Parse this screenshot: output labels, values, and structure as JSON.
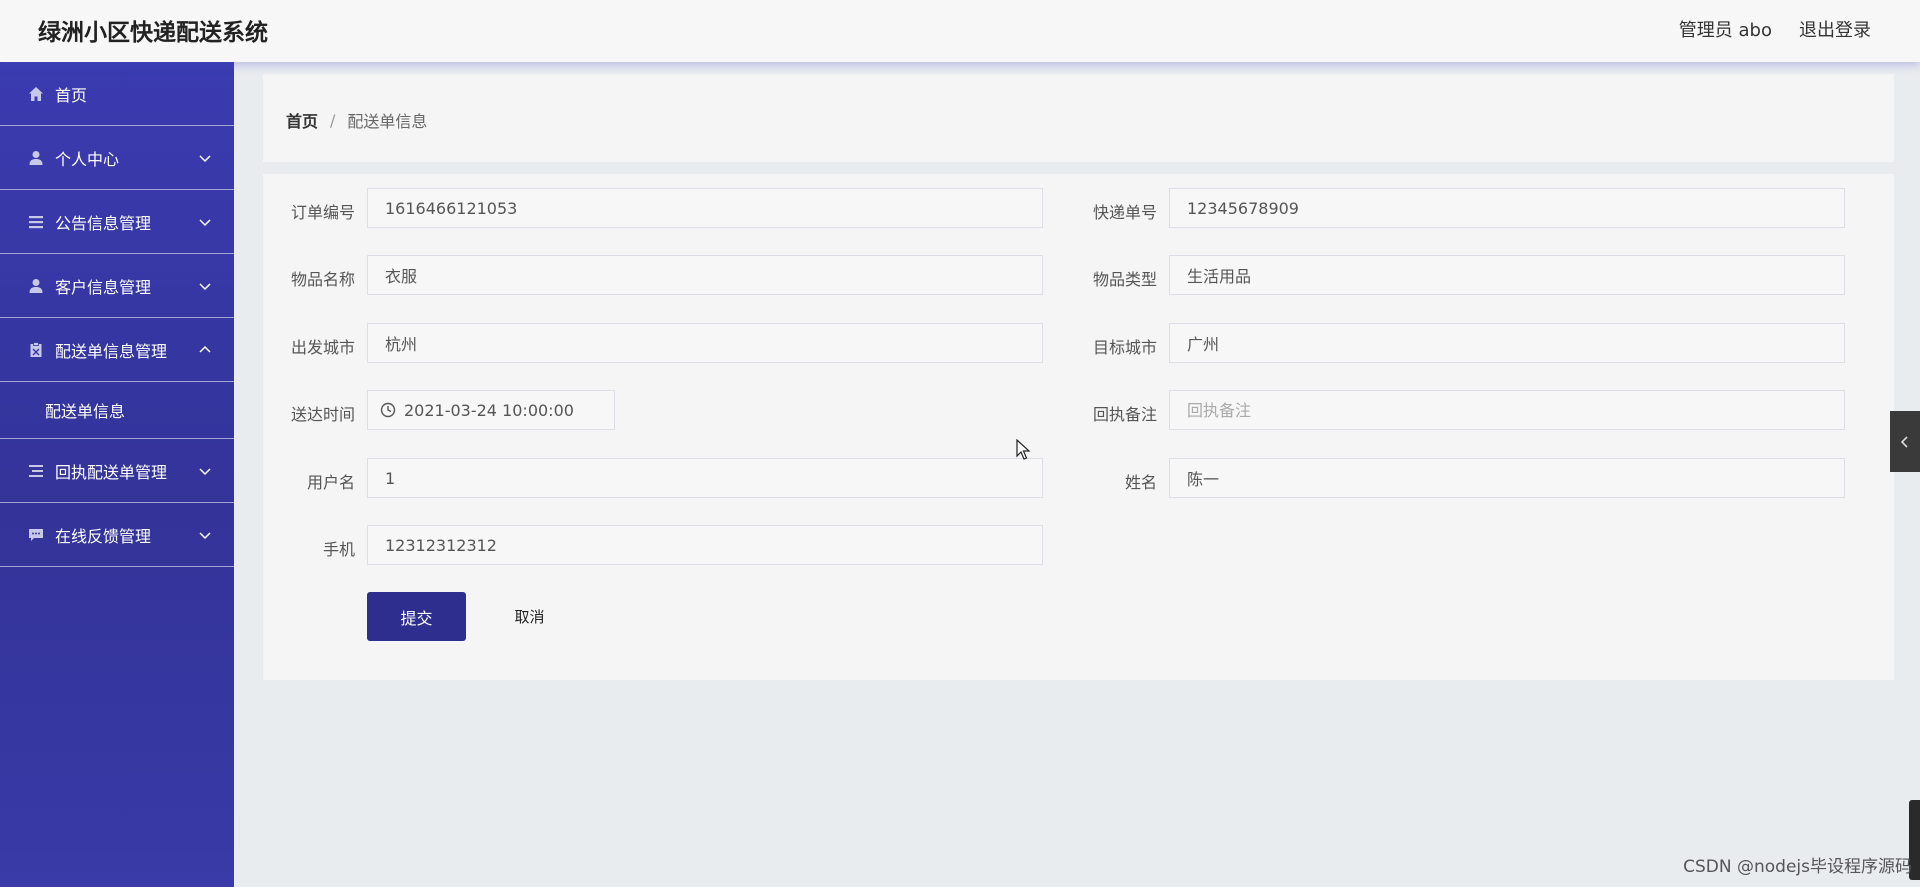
{
  "header": {
    "title": "绿洲小区快递配送系统",
    "user_label": "管理员 abo",
    "logout_label": "退出登录"
  },
  "sidebar": {
    "items": [
      {
        "label": "首页",
        "icon": "home-icon"
      },
      {
        "label": "个人中心",
        "icon": "user-icon",
        "expanded": false
      },
      {
        "label": "公告信息管理",
        "icon": "list-icon",
        "expanded": false
      },
      {
        "label": "客户信息管理",
        "icon": "user-icon",
        "expanded": false
      },
      {
        "label": "配送单信息管理",
        "icon": "clipboard-icon",
        "expanded": true,
        "children": [
          {
            "label": "配送单信息"
          }
        ]
      },
      {
        "label": "回执配送单管理",
        "icon": "menu-icon",
        "expanded": false
      },
      {
        "label": "在线反馈管理",
        "icon": "message-icon",
        "expanded": false
      }
    ]
  },
  "breadcrumb": {
    "home": "首页",
    "separator": "/",
    "current": "配送单信息"
  },
  "form": {
    "order_no": {
      "label": "订单编号",
      "value": "1616466121053"
    },
    "express_no": {
      "label": "快递单号",
      "value": "12345678909"
    },
    "item_name": {
      "label": "物品名称",
      "value": "衣服"
    },
    "item_type": {
      "label": "物品类型",
      "value": "生活用品"
    },
    "from_city": {
      "label": "出发城市",
      "value": "杭州"
    },
    "to_city": {
      "label": "目标城市",
      "value": "广州"
    },
    "delivery_time": {
      "label": "送达时间",
      "value": "2021-03-24 10:00:00"
    },
    "receipt_note": {
      "label": "回执备注",
      "value": "",
      "placeholder": "回执备注"
    },
    "username": {
      "label": "用户名",
      "value": "1"
    },
    "name": {
      "label": "姓名",
      "value": "陈一"
    },
    "phone": {
      "label": "手机",
      "value": "12312312312"
    },
    "submit_label": "提交",
    "cancel_label": "取消"
  },
  "watermark": "CSDN @nodejs毕设程序源码",
  "colors": {
    "sidebar": "#3535a6",
    "primary_button": "#2e2e8f",
    "card": "#f5f5f5",
    "page_bg": "#e9ecef"
  }
}
